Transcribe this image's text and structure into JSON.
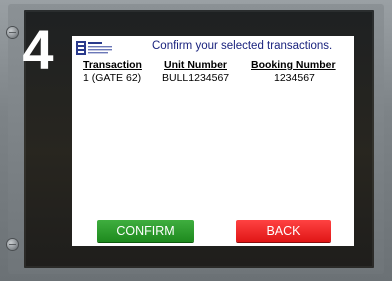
{
  "step_number": "4",
  "header": {
    "title": "Confirm your selected transactions."
  },
  "table": {
    "columns": [
      "Transaction",
      "Unit Number",
      "Booking Number"
    ],
    "rows": [
      [
        "1 (GATE 62)",
        "BULL1234567",
        "1234567"
      ]
    ]
  },
  "buttons": {
    "confirm_label": "CONFIRM",
    "back_label": "BACK"
  },
  "colors": {
    "confirm": "#1e8a1e",
    "back": "#e01616",
    "header_text": "#1a237e",
    "logo_blue": "#2a3a8c"
  }
}
